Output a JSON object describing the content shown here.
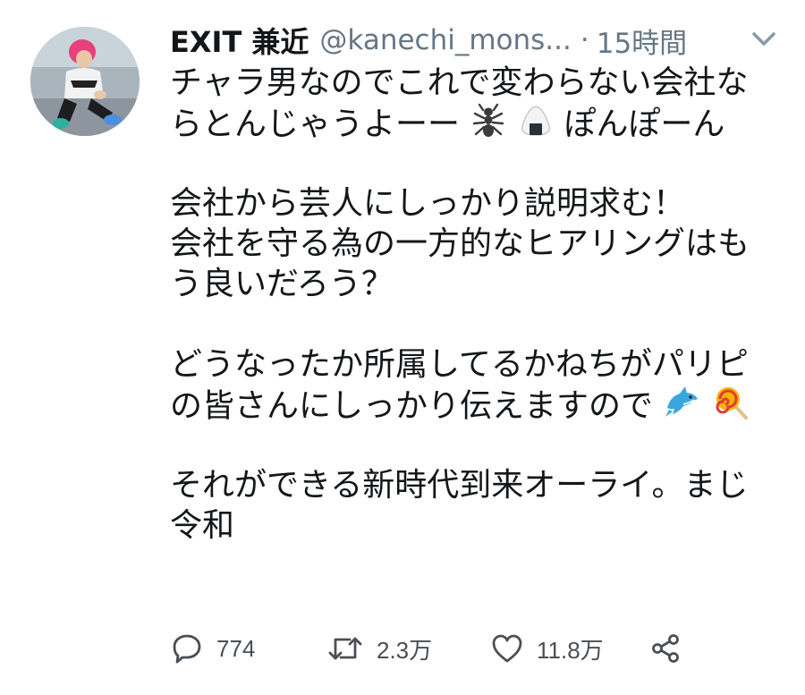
{
  "tweet": {
    "display_name": "EXIT 兼近",
    "handle": "@kanechi_mons...",
    "separator": "·",
    "time": "15時間",
    "lines": [
      "チャラ男なのでこれで変わらない会社な",
      "らとんじゃうよーー",
      "ぽんぽーん",
      "会社から芸人にしっかり説明求む！",
      "会社を守る為の一方的なヒアリングはも",
      "う良いだろう？",
      "どうなったか所属してるかねちがパリピ",
      "の皆さんにしっかり伝えますので",
      "それができる新時代到来オーライ。まじ",
      "令和"
    ]
  },
  "actions": {
    "reply_count": "774",
    "retweet_count": "2.3万",
    "like_count": "11.8万"
  },
  "icons": [
    "ant-emoji-icon",
    "rice-ball-emoji-icon",
    "dolphin-emoji-icon",
    "lollipop-emoji-icon",
    "reply-icon",
    "retweet-icon",
    "like-icon",
    "share-icon",
    "chevron-down-icon"
  ],
  "colors": {
    "text": "#14171a",
    "secondary": "#657786",
    "accent_hair": "#e8407a"
  }
}
